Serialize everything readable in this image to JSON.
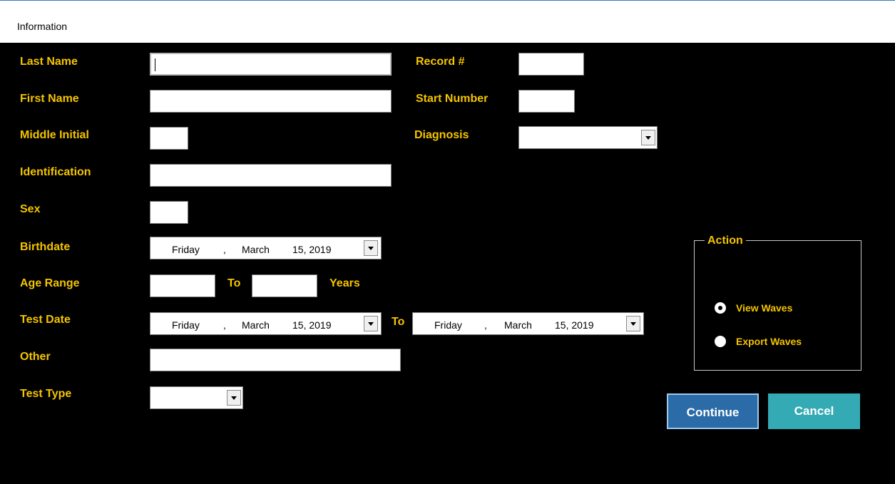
{
  "window": {
    "title": "Information"
  },
  "labels": {
    "last_name": "Last Name",
    "first_name": "First Name",
    "middle_initial": "Middle Initial",
    "identification": "Identification",
    "sex": "Sex",
    "birthdate": "Birthdate",
    "age_range": "Age Range",
    "age_to": "To",
    "years": "Years",
    "test_date": "Test Date",
    "test_date_to": "To",
    "other": "Other",
    "test_type": "Test Type",
    "record": "Record #",
    "start_number": "Start Number",
    "diagnosis": "Diagnosis"
  },
  "dates": {
    "birthdate": {
      "weekday": "Friday",
      "sep": ",",
      "month": "March",
      "daynum": "15, 2019"
    },
    "test_from": {
      "weekday": "Friday",
      "sep": ",",
      "month": "March",
      "daynum": "15, 2019"
    },
    "test_to": {
      "weekday": "Friday",
      "sep": ",",
      "month": "March",
      "daynum": "15, 2019"
    }
  },
  "action": {
    "legend": "Action",
    "options": [
      {
        "label": "View Waves",
        "selected": true
      },
      {
        "label": "Export Waves",
        "selected": false
      }
    ]
  },
  "buttons": {
    "continue": "Continue",
    "cancel": "Cancel"
  },
  "colors": {
    "label": "#f4c400",
    "background": "#000000",
    "continue_bg": "#2b6ca8",
    "cancel_bg": "#34aab4"
  }
}
